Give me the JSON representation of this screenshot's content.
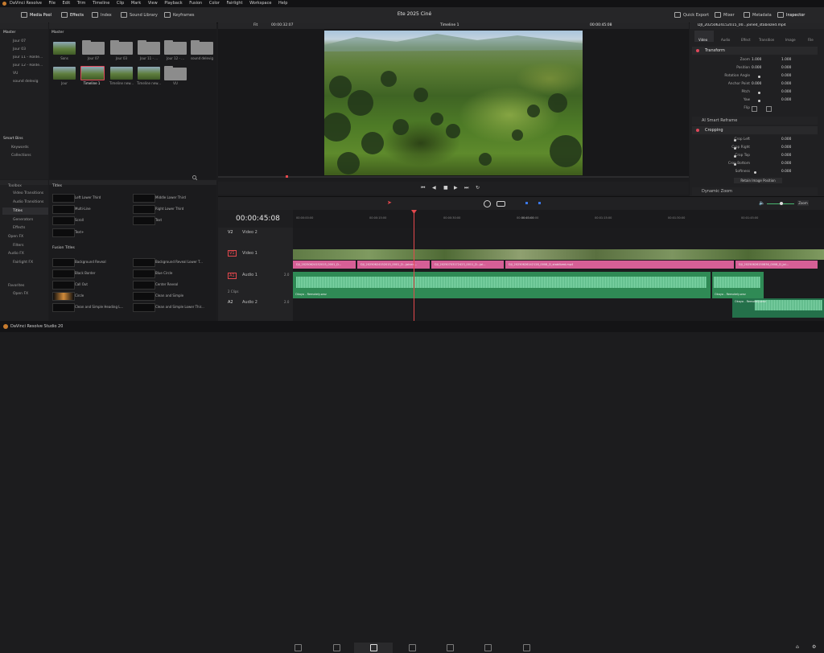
{
  "app": {
    "name": "DaVinci Resolve",
    "version_label": "DaVinci Resolve Studio 20"
  },
  "menu": [
    "DaVinci Resolve",
    "File",
    "Edit",
    "Trim",
    "Timeline",
    "Clip",
    "Mark",
    "View",
    "Playback",
    "Fusion",
    "Color",
    "Fairlight",
    "Workspace",
    "Help"
  ],
  "toolbar": {
    "media_pool": "Media Pool",
    "effects": "Effects",
    "index": "Index",
    "sound_library": "Sound Library",
    "keyframes": "Keyframes",
    "project_title": "Ete 2025 Ciné",
    "quick_export": "Quick Export",
    "mixer": "Mixer",
    "metadata": "Metadata",
    "inspector": "Inspector"
  },
  "viewer": {
    "zoom": "Fit",
    "source_timecode": "00:00:32:07",
    "timeline_name": "Timeline 1",
    "record_timecode": "00:00:45:08"
  },
  "bins": {
    "root": "Master",
    "items": [
      "Jour 07",
      "Jour 03",
      "Jour 11 - Rolde...",
      "Jour 12 - Rolde...",
      "VU",
      "sound delevig"
    ],
    "smart_bins": "Smart Bins",
    "smart_items": [
      "Keywords",
      "Collections"
    ]
  },
  "media": {
    "header": "Master",
    "row1": [
      "Sons",
      "Jour 07",
      "Jour 03",
      "Jour 11 - ...",
      "Jour 12 - ...",
      "sound delevig"
    ],
    "row2": [
      "Jour",
      "Timeline 1",
      "Timeline new...",
      "Timeline new...",
      "VU"
    ]
  },
  "effects": {
    "tree": [
      "Toolbox",
      "Video Transitions",
      "Audio Transitions",
      "Titles",
      "Generators",
      "Effects",
      "Open FX",
      "Filters",
      "Audio FX",
      "Fairlight FX",
      "Favorites",
      "Open FX"
    ],
    "titles_header": "Titles",
    "titles": [
      "Left Lower Third",
      "Middle Lower Third",
      "Multi-Line",
      "Right Lower Third",
      "Scroll",
      "Text",
      "Text+"
    ],
    "fusion_header": "Fusion Titles",
    "fusion": [
      "Background Reveal",
      "Background Reveal Lower T...",
      "Black Border",
      "Blue Circle",
      "Call Out",
      "Center Reveal",
      "Circle",
      "Clean and Simple",
      "Clean and Simple Heading L...",
      "Clean and Simple Lower Thir..."
    ]
  },
  "inspector": {
    "clip_name": "DJI_20250624152015_00...joined_stabilized.mp4",
    "tabs": [
      "Video",
      "Audio",
      "Effect",
      "Transition",
      "Image",
      "File"
    ],
    "transform_header": "Transform",
    "rows": [
      {
        "label": "Zoom",
        "x": "1.000",
        "y": "1.000"
      },
      {
        "label": "Position",
        "x": "0.000",
        "y": "0.000"
      },
      {
        "label": "Rotation Angle",
        "x": "0.000",
        "y": ""
      },
      {
        "label": "Anchor Point",
        "x": "0.000",
        "y": "0.000"
      },
      {
        "label": "Pitch",
        "x": "0.000",
        "y": ""
      },
      {
        "label": "Yaw",
        "x": "0.000",
        "y": ""
      },
      {
        "label": "Flip",
        "x": "",
        "y": ""
      }
    ],
    "smart_reframe": "AI Smart Reframe",
    "cropping_header": "Cropping",
    "crop_rows": [
      {
        "label": "Crop Left",
        "val": "0.000"
      },
      {
        "label": "Crop Right",
        "val": "0.000"
      },
      {
        "label": "Crop Top",
        "val": "0.000"
      },
      {
        "label": "Crop Bottom",
        "val": "0.000"
      },
      {
        "label": "Softness",
        "val": "0.000"
      }
    ],
    "retain_button": "Retain Image Position",
    "dynamic_zoom": "Dynamic Zoom"
  },
  "timeline": {
    "timecode": "00:00:45:08",
    "ruler": [
      "00:00:00:00",
      "00:00:15:00",
      "00:00:30:00",
      "00:00:45:00",
      "00:01:00:00",
      "00:01:15:00",
      "00:01:30:00",
      "00:01:45:00"
    ],
    "tracks": [
      {
        "id": "V2",
        "name": "Video 2",
        "meta": ""
      },
      {
        "id": "V1",
        "name": "Video 1",
        "meta": ""
      },
      {
        "id": "A1",
        "name": "Audio 1",
        "meta": "2 Clips",
        "level": "2.0"
      },
      {
        "id": "A2",
        "name": "Audio 2",
        "meta": "",
        "level": "2.0"
      }
    ],
    "video_clips": [
      "DJI_20250624152015_0001_D...",
      "DJI_20250624152015_0001_D...joined...",
      "DJI_20250703172423_0011_D...joi...",
      "DJI_20250626142128_0008_D_stabilized.mp4",
      "DJI_20250626150836_0008_D_joi..."
    ],
    "audio_clips": [
      "Okayo - Remotely.wav",
      "Okayo - Remotely.wav",
      "Okayo - Remotely.wav"
    ],
    "zoom_label": "Zoom"
  },
  "colors": {
    "accent": "#e0485a",
    "video_clip": "#d65f96",
    "audio_clip": "#2f8a55",
    "playhead": "#e5484d"
  }
}
